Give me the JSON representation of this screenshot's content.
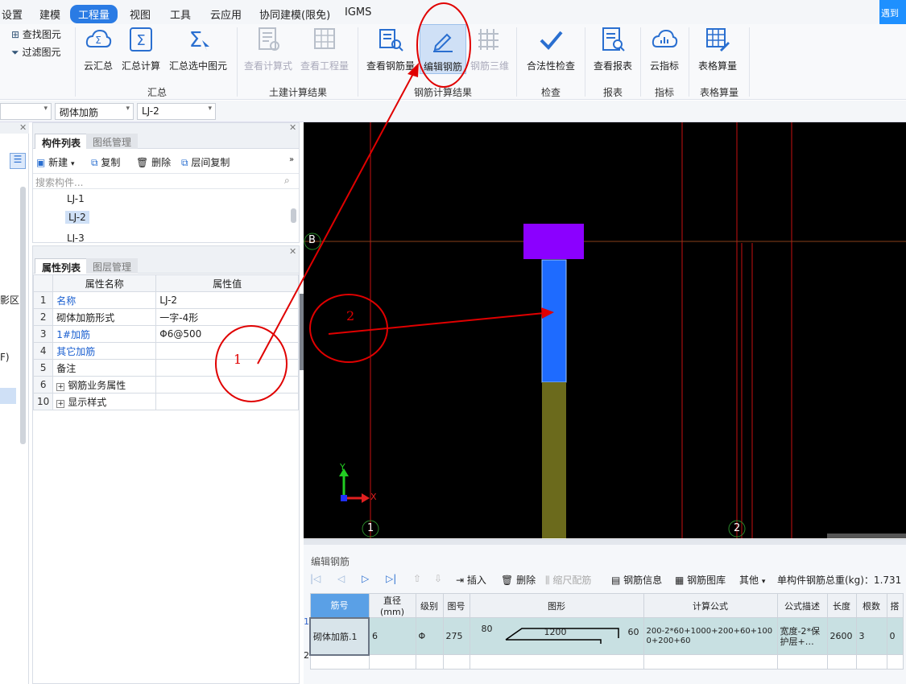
{
  "menu": {
    "items": [
      "设置",
      "建模",
      "工程量",
      "视图",
      "工具",
      "云应用",
      "协同建模(限免)",
      "IGMS"
    ],
    "active": "工程量",
    "corner_button": "遇到"
  },
  "ribbon": {
    "side": {
      "find": "查找图元",
      "filter": "过滤图元"
    },
    "groups": {
      "summary": {
        "label": "汇总",
        "buttons": [
          "云汇总",
          "汇总计算",
          "汇总选中图元"
        ]
      },
      "civil": {
        "label": "土建计算结果",
        "buttons": [
          "查看计算式",
          "查看工程量"
        ]
      },
      "rebar": {
        "label": "钢筋计算结果",
        "buttons": [
          "查看钢筋量",
          "编辑钢筋",
          "钢筋三维"
        ]
      },
      "check": {
        "label": "检查",
        "buttons": [
          "合法性检查"
        ]
      },
      "report": {
        "label": "报表",
        "buttons": [
          "查看报表"
        ]
      },
      "index": {
        "label": "指标",
        "buttons": [
          "云指标"
        ]
      },
      "table": {
        "label": "表格算量",
        "buttons": [
          "表格算量"
        ]
      }
    }
  },
  "dropdowns": {
    "type": "砌体加筋",
    "item": "LJ-2"
  },
  "component_pane": {
    "tabs": [
      "构件列表",
      "图纸管理"
    ],
    "tools": {
      "new": "新建",
      "copy": "复制",
      "delete": "删除",
      "floor_copy": "层间复制"
    },
    "search_placeholder": "搜索构件...",
    "items": [
      "LJ-1",
      "LJ-2",
      "LJ-3"
    ],
    "selected": "LJ-2"
  },
  "property_pane": {
    "tabs": [
      "属性列表",
      "图层管理"
    ],
    "headers": [
      "属性名称",
      "属性值"
    ],
    "rows": [
      {
        "n": "1",
        "name": "名称",
        "value": "LJ-2"
      },
      {
        "n": "2",
        "name": "砌体加筋形式",
        "value": "一字-4形"
      },
      {
        "n": "3",
        "name": "1#加筋",
        "value": "Φ6@500"
      },
      {
        "n": "4",
        "name": "其它加筋",
        "value": ""
      },
      {
        "n": "5",
        "name": "备注",
        "value": ""
      },
      {
        "n": "6",
        "name": "钢筋业务属性",
        "value": ""
      },
      {
        "n": "10",
        "name": "显示样式",
        "value": ""
      }
    ]
  },
  "left_edge": {
    "label_a": "影区",
    "label_b": "F)"
  },
  "canvas": {
    "axis_b": "B",
    "axis_1": "1",
    "axis_2": "2",
    "axis_x": "X",
    "axis_y": "Y",
    "annotation_1": "1",
    "annotation_2": "2"
  },
  "editor": {
    "title": "编辑钢筋",
    "tools": {
      "insert": "插入",
      "delete": "删除",
      "scale": "缩尺配筋",
      "info": "钢筋信息",
      "library": "钢筋图库",
      "other": "其他"
    },
    "total_weight": "单构件钢筋总重(kg)：1.731",
    "headers": [
      "筋号",
      "直径(mm)",
      "级别",
      "图号",
      "图形",
      "计算公式",
      "公式描述",
      "长度",
      "根数",
      "搭"
    ],
    "row": {
      "index": "1",
      "name": "砌体加筋.1",
      "diameter": "6",
      "grade": "Φ",
      "fig_no": "275",
      "shape_left": "80",
      "shape_mid": "1200",
      "shape_right": "60",
      "formula": "200-2*60+1000+200+60+1000+200+60",
      "formula_desc": "宽度-2*保护层+…",
      "length": "2600",
      "count": "3",
      "lap": "0"
    },
    "row2_index": "2"
  },
  "colors": {
    "accent": "#2a7be4",
    "highlight_red": "#e00000",
    "purple": "#8b00ff",
    "blue_block": "#1e6bff",
    "olive": "#6b6a1c"
  }
}
